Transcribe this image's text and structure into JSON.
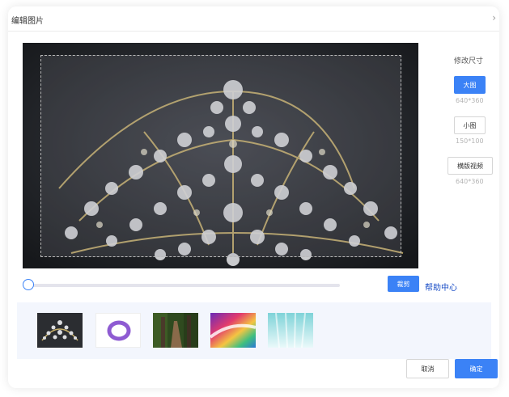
{
  "dialog": {
    "title": "编辑图片",
    "close_icon": "chevron-right-icon"
  },
  "sizes": {
    "title": "修改尺寸",
    "options": [
      {
        "label": "大图",
        "dims": "640*360",
        "active": true
      },
      {
        "label": "小图",
        "dims": "150*100",
        "active": false
      },
      {
        "label": "横版视频",
        "dims": "640*360",
        "active": false
      }
    ]
  },
  "zoom": {
    "value": 0
  },
  "toolbar": {
    "crop_label": "裁剪",
    "help_label": "帮助中心"
  },
  "thumbnails": [
    {
      "name": "crown"
    },
    {
      "name": "purple-ring"
    },
    {
      "name": "forest-path"
    },
    {
      "name": "colorful-swirl"
    },
    {
      "name": "light-rays"
    }
  ],
  "footer": {
    "cancel_label": "取消",
    "ok_label": "确定"
  },
  "colors": {
    "accent": "#3b82f6",
    "link": "#1a4ec7",
    "strip_bg": "#f3f6fd"
  }
}
